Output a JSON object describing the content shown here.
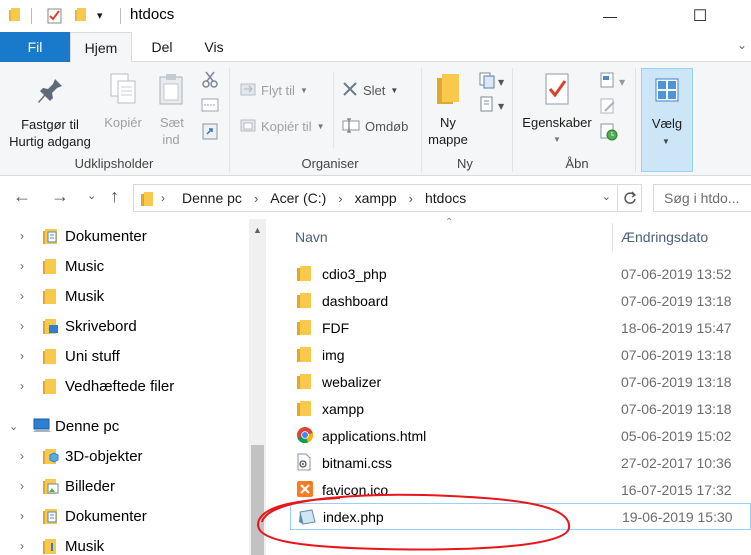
{
  "titlebar": {
    "title": "htdocs",
    "qa_dropdown": "▾",
    "minimize": "—",
    "maximize": "☐"
  },
  "tabs": [
    "Fil",
    "Hjem",
    "Del",
    "Vis"
  ],
  "ribbon": {
    "clipboard": {
      "pin_label": "Fastgør til Hurtig adgang",
      "copy_label": "Kopiér",
      "paste_label": "Sæt ind",
      "group_label": "Udklipsholder"
    },
    "organize": {
      "move_label": "Flyt til",
      "copy_to_label": "Kopiér til",
      "delete_label": "Slet",
      "rename_label": "Omdøb",
      "group_label": "Organiser"
    },
    "new": {
      "new_folder_label": "Ny mappe",
      "group_label": "Ny"
    },
    "open": {
      "properties_label": "Egenskaber",
      "group_label": "Åbn"
    },
    "select": {
      "select_label": "Vælg"
    }
  },
  "address": {
    "crumbs": [
      "Denne pc",
      "Acer (C:)",
      "xampp",
      "htdocs"
    ],
    "search_placeholder": "Søg i htdo..."
  },
  "navpane": {
    "items": [
      {
        "label": "Dokumenter",
        "icon": "documents-icon"
      },
      {
        "label": "Music",
        "icon": "folder-icon"
      },
      {
        "label": "Musik",
        "icon": "folder-icon"
      },
      {
        "label": "Skrivebord",
        "icon": "desktop-icon"
      },
      {
        "label": "Uni stuff",
        "icon": "folder-icon"
      },
      {
        "label": "Vedhæftede filer",
        "icon": "folder-icon"
      },
      {
        "label": "Denne pc",
        "icon": "computer-icon"
      },
      {
        "label": "3D-objekter",
        "icon": "3d-objects-icon"
      },
      {
        "label": "Billeder",
        "icon": "pictures-icon"
      },
      {
        "label": "Dokumenter",
        "icon": "documents-icon"
      },
      {
        "label": "Musik",
        "icon": "music-folder-icon"
      }
    ]
  },
  "filelist": {
    "col_name": "Navn",
    "col_date": "Ændringsdato",
    "files": [
      {
        "name": "cdio3_php",
        "date": "07-06-2019 13:52",
        "type": "folder"
      },
      {
        "name": "dashboard",
        "date": "07-06-2019 13:18",
        "type": "folder"
      },
      {
        "name": "FDF",
        "date": "18-06-2019 15:47",
        "type": "folder"
      },
      {
        "name": "img",
        "date": "07-06-2019 13:18",
        "type": "folder"
      },
      {
        "name": "webalizer",
        "date": "07-06-2019 13:18",
        "type": "folder"
      },
      {
        "name": "xampp",
        "date": "07-06-2019 13:18",
        "type": "folder"
      },
      {
        "name": "applications.html",
        "date": "05-06-2019 15:02",
        "type": "chrome-html"
      },
      {
        "name": "bitnami.css",
        "date": "27-02-2017 10:36",
        "type": "css"
      },
      {
        "name": "favicon.ico",
        "date": "16-07-2015 17:32",
        "type": "ico"
      },
      {
        "name": "index.php",
        "date": "19-06-2019 15:30",
        "type": "php"
      }
    ]
  },
  "colors": {
    "accent": "#1979ca",
    "folder": "#f8c94b",
    "annotation": "#e8161b"
  }
}
